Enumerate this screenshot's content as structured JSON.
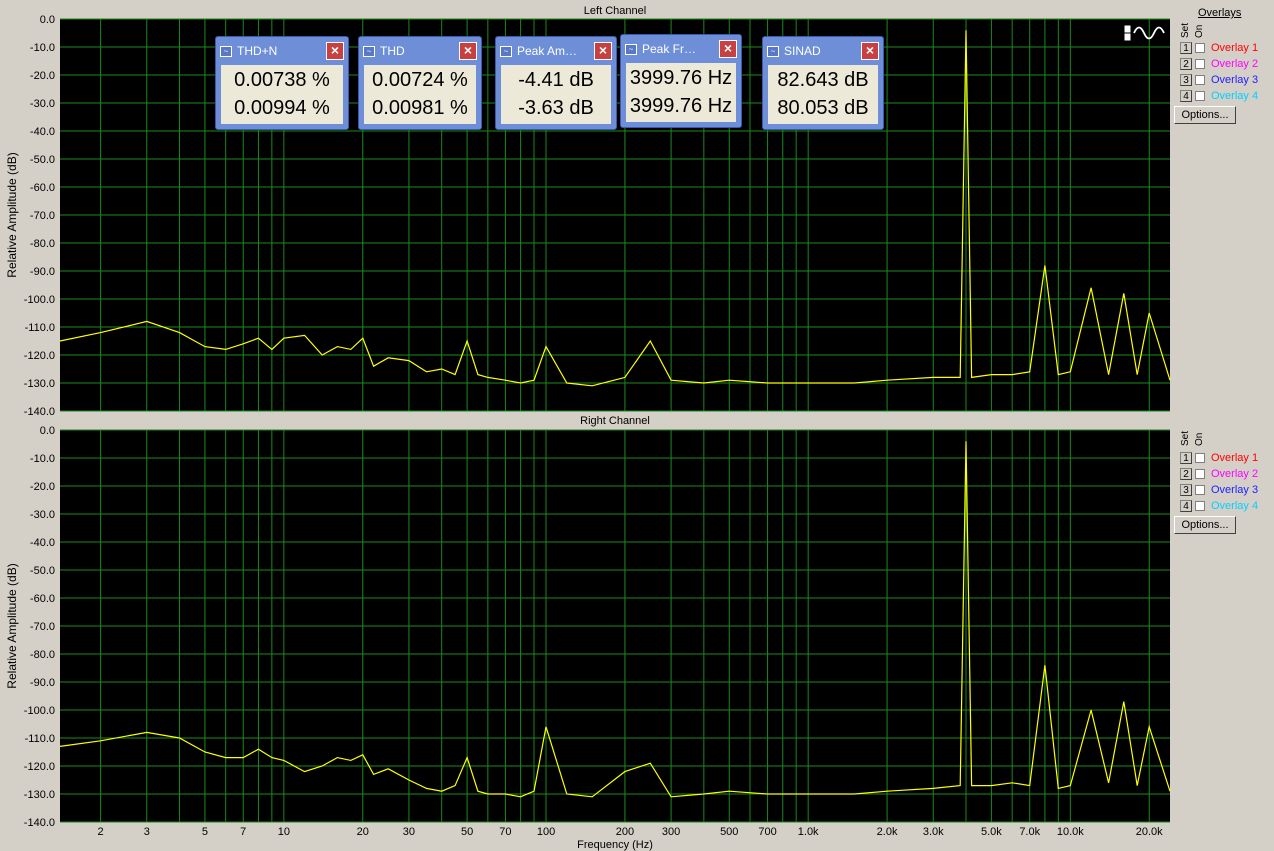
{
  "overlays": {
    "title": "Overlays",
    "set_label": "Set",
    "on_label": "On",
    "items": [
      {
        "num": "1",
        "label": "Overlay 1",
        "color": "#ff0000"
      },
      {
        "num": "2",
        "label": "Overlay 2",
        "color": "#ff00ff"
      },
      {
        "num": "3",
        "label": "Overlay 3",
        "color": "#2020ff"
      },
      {
        "num": "4",
        "label": "Overlay 4",
        "color": "#00d0ff"
      }
    ],
    "options_label": "Options..."
  },
  "meters": [
    {
      "title": "THD+N",
      "value1": "0.00738 %",
      "value2": "0.00994 %"
    },
    {
      "title": "THD",
      "value1": "0.00724 %",
      "value2": "0.00981 %"
    },
    {
      "title": "Peak Am…",
      "value1": "-4.41 dB",
      "value2": "-3.63 dB"
    },
    {
      "title": "Peak Fr…",
      "value1": "3999.76 Hz",
      "value2": "3999.76 Hz"
    },
    {
      "title": "SINAD",
      "value1": "82.643 dB",
      "value2": "80.053 dB"
    }
  ],
  "chart_data": [
    {
      "type": "line",
      "title": "Left Channel",
      "xlabel": "",
      "ylabel": "Relative Amplitude (dB)",
      "x_scale": "log",
      "xlim": [
        1.4,
        24000
      ],
      "ylim": [
        -140,
        0
      ],
      "grid": true,
      "yticks": [
        "0.0",
        "-10.0",
        "-20.0",
        "-30.0",
        "-40.0",
        "-50.0",
        "-60.0",
        "-70.0",
        "-80.0",
        "-90.0",
        "-100.0",
        "-110.0",
        "-120.0",
        "-130.0",
        "-140.0"
      ],
      "series": [
        {
          "color": "#ffff00",
          "x": [
            1.4,
            2,
            3,
            4,
            5,
            6,
            7,
            8,
            9,
            10,
            12,
            14,
            16,
            18,
            20,
            22,
            25,
            30,
            35,
            40,
            45,
            50,
            55,
            60,
            70,
            80,
            90,
            100,
            120,
            150,
            200,
            250,
            300,
            400,
            500,
            700,
            1000,
            1500,
            2000,
            3000,
            3800,
            4000,
            4200,
            5000,
            6000,
            7000,
            8000,
            9000,
            10000,
            12000,
            14000,
            16000,
            18000,
            20000,
            24000
          ],
          "y": [
            -115,
            -112,
            -108,
            -112,
            -117,
            -118,
            -116,
            -114,
            -118,
            -114,
            -113,
            -120,
            -117,
            -118,
            -114,
            -124,
            -121,
            -122,
            -126,
            -125,
            -127,
            -115,
            -127,
            -128,
            -129,
            -130,
            -129,
            -117,
            -130,
            -131,
            -128,
            -115,
            -129,
            -130,
            -129,
            -130,
            -130,
            -130,
            -129,
            -128,
            -128,
            -4,
            -128,
            -127,
            -127,
            -126,
            -88,
            -127,
            -126,
            -96,
            -127,
            -98,
            -127,
            -105,
            -129
          ]
        }
      ]
    },
    {
      "type": "line",
      "title": "Right Channel",
      "xlabel": "Frequency (Hz)",
      "ylabel": "Relative Amplitude (dB)",
      "x_scale": "log",
      "xlim": [
        1.4,
        24000
      ],
      "ylim": [
        -140,
        0
      ],
      "grid": true,
      "yticks": [
        "0.0",
        "-10.0",
        "-20.0",
        "-30.0",
        "-40.0",
        "-50.0",
        "-60.0",
        "-70.0",
        "-80.0",
        "-90.0",
        "-100.0",
        "-110.0",
        "-120.0",
        "-130.0",
        "-140.0"
      ],
      "xticks": [
        "2",
        "3",
        "5",
        "7",
        "10",
        "20",
        "30",
        "50",
        "70",
        "100",
        "200",
        "300",
        "500",
        "700",
        "1.0k",
        "2.0k",
        "3.0k",
        "5.0k",
        "7.0k",
        "10.0k",
        "20.0k"
      ],
      "xtick_values": [
        2,
        3,
        5,
        7,
        10,
        20,
        30,
        50,
        70,
        100,
        200,
        300,
        500,
        700,
        1000,
        2000,
        3000,
        5000,
        7000,
        10000,
        20000
      ],
      "series": [
        {
          "color": "#ffff00",
          "x": [
            1.4,
            2,
            3,
            4,
            5,
            6,
            7,
            8,
            9,
            10,
            12,
            14,
            16,
            18,
            20,
            22,
            25,
            30,
            35,
            40,
            45,
            50,
            55,
            60,
            70,
            80,
            90,
            100,
            120,
            150,
            200,
            250,
            300,
            400,
            500,
            700,
            1000,
            1500,
            2000,
            3000,
            3800,
            4000,
            4200,
            5000,
            6000,
            7000,
            8000,
            9000,
            10000,
            12000,
            14000,
            16000,
            18000,
            20000,
            24000
          ],
          "y": [
            -113,
            -111,
            -108,
            -110,
            -115,
            -117,
            -117,
            -114,
            -117,
            -118,
            -122,
            -120,
            -117,
            -118,
            -116,
            -123,
            -121,
            -125,
            -128,
            -129,
            -127,
            -117,
            -129,
            -130,
            -130,
            -131,
            -129,
            -106,
            -130,
            -131,
            -122,
            -119,
            -131,
            -130,
            -129,
            -130,
            -130,
            -130,
            -129,
            -128,
            -127,
            -4,
            -127,
            -127,
            -126,
            -127,
            -84,
            -128,
            -127,
            -100,
            -126,
            -97,
            -127,
            -106,
            -129
          ]
        }
      ]
    }
  ]
}
